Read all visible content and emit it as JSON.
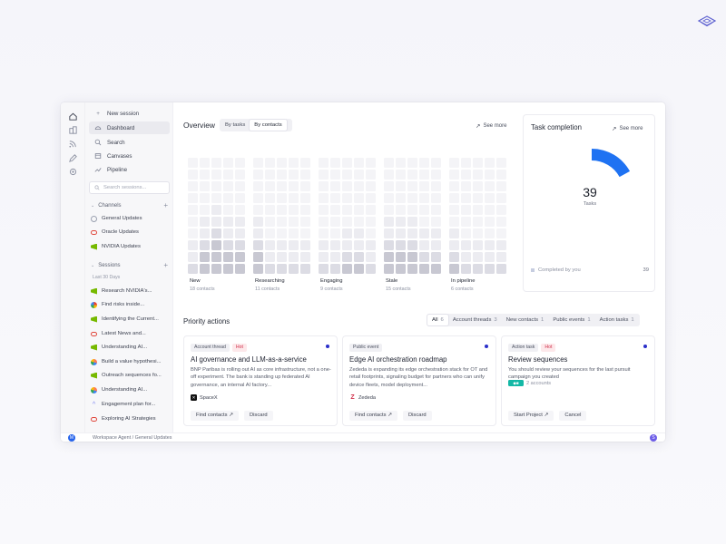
{
  "colors": {
    "accent": "#1f72f2",
    "hot": "#d0304a",
    "cell_light": "#ececf1",
    "cell_mid": "#dcdce4",
    "cell_dark": "#c8c8d2"
  },
  "sidebar": {
    "new_session": "New session",
    "nav": [
      {
        "label": "Dashboard",
        "icon": "dashboard-icon",
        "active": true
      },
      {
        "label": "Search",
        "icon": "search-icon"
      },
      {
        "label": "Canvases",
        "icon": "canvas-icon"
      },
      {
        "label": "Pipeline",
        "icon": "pipeline-icon"
      }
    ],
    "search_placeholder": "Search sessions...",
    "channels_label": "Channels",
    "channels": [
      {
        "label": "General Updates",
        "logo": "globe"
      },
      {
        "label": "Oracle Updates",
        "logo": "oracle"
      },
      {
        "label": "NVIDIA Updates",
        "logo": "nvidia"
      }
    ],
    "sessions_label": "Sessions",
    "sessions_sub": "Last 30 Days",
    "sessions": [
      {
        "label": "Research NVIDIA's...",
        "logo": "nvidia"
      },
      {
        "label": "Find risks inside...",
        "logo": "google"
      },
      {
        "label": "Identifying the Current...",
        "logo": "nvidia"
      },
      {
        "label": "Latest News and...",
        "logo": "oracle"
      },
      {
        "label": "Understanding AI...",
        "logo": "nvidia"
      },
      {
        "label": "Build a value hypothesi...",
        "logo": "hubspot"
      },
      {
        "label": "Outreach sequences fo...",
        "logo": "nvidia"
      },
      {
        "label": "Understanding AI...",
        "logo": "hubspot"
      },
      {
        "label": "Engagement plan for...",
        "logo": "gen"
      },
      {
        "label": "Exploring AI Strategies",
        "logo": "oracle"
      }
    ]
  },
  "overview": {
    "title": "Overview",
    "toggle": [
      "By tasks",
      "By contacts"
    ],
    "toggle_selected": 1,
    "see_more": "See more",
    "columns": [
      {
        "label": "New",
        "sub": "18 contacts",
        "heights": [
          1,
          3,
          4,
          3,
          3
        ]
      },
      {
        "label": "Researching",
        "sub": "11 contacts",
        "heights": [
          3,
          1,
          1,
          1,
          1
        ]
      },
      {
        "label": "Engaging",
        "sub": "9 contacts",
        "heights": [
          1,
          1,
          2,
          2,
          1
        ]
      },
      {
        "label": "Stale",
        "sub": "15 contacts",
        "heights": [
          3,
          3,
          3,
          2,
          2
        ]
      },
      {
        "label": "In pipeline",
        "sub": "6 contacts",
        "heights": [
          2,
          1,
          1,
          1,
          1
        ]
      }
    ]
  },
  "task_completion": {
    "title": "Task completion",
    "see_more": "See more",
    "value": "39",
    "value_label": "Tasks",
    "progress_fraction": 0.17,
    "legend_label": "Completed by you",
    "legend_value": "39"
  },
  "priority": {
    "title": "Priority actions",
    "filters": [
      {
        "label": "All",
        "count": "6",
        "on": true
      },
      {
        "label": "Account threads",
        "count": "3"
      },
      {
        "label": "New contacts",
        "count": "1"
      },
      {
        "label": "Public events",
        "count": "1"
      },
      {
        "label": "Action tasks",
        "count": "1"
      }
    ],
    "cards": [
      {
        "badge": "Account thread",
        "hot": "Hot",
        "title": "AI governance and LLM-as-a-service",
        "body": "BNP Paribas is rolling out AI as core infrastructure, not a one-off experiment. The bank is standing up federated AI governance, an internal AI factory...",
        "company": "SpaceX",
        "btn1": "Find contacts",
        "btn2": "Discard"
      },
      {
        "badge": "Public event",
        "hot": "",
        "title": "Edge AI orchestration roadmap",
        "body": "Zededa is expanding its edge orchestration stack for OT and retail footprints, signaling budget for partners who can unify device fleets, model deployment...",
        "company": "Zededa",
        "btn1": "Find contacts",
        "btn2": "Discard"
      },
      {
        "badge": "Action task",
        "hot": "Hot",
        "title": "Review sequences",
        "body": "You should review your sequences for the last pursuit campaign you created",
        "company": "2 accounts",
        "btn1": "Start Project",
        "btn2": "Cancel"
      }
    ]
  },
  "statusbar": {
    "avatar": "M",
    "path": "Workspace Agent / General Updates",
    "help": "S"
  }
}
